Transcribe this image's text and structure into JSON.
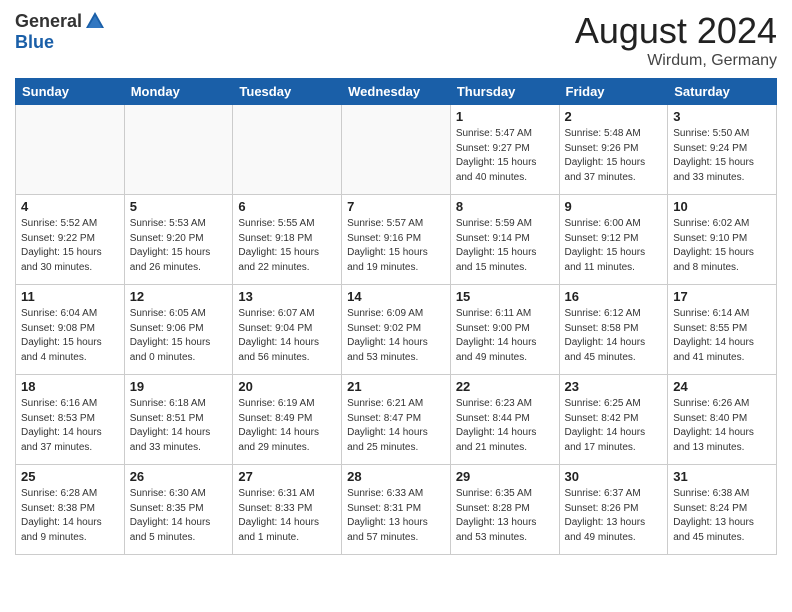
{
  "header": {
    "logo_general": "General",
    "logo_blue": "Blue",
    "month_year": "August 2024",
    "location": "Wirdum, Germany"
  },
  "days_of_week": [
    "Sunday",
    "Monday",
    "Tuesday",
    "Wednesday",
    "Thursday",
    "Friday",
    "Saturday"
  ],
  "weeks": [
    [
      {
        "day": "",
        "sunrise": "",
        "sunset": "",
        "daylight": ""
      },
      {
        "day": "",
        "sunrise": "",
        "sunset": "",
        "daylight": ""
      },
      {
        "day": "",
        "sunrise": "",
        "sunset": "",
        "daylight": ""
      },
      {
        "day": "",
        "sunrise": "",
        "sunset": "",
        "daylight": ""
      },
      {
        "day": "1",
        "sunrise": "5:47 AM",
        "sunset": "9:27 PM",
        "daylight": "15 hours and 40 minutes."
      },
      {
        "day": "2",
        "sunrise": "5:48 AM",
        "sunset": "9:26 PM",
        "daylight": "15 hours and 37 minutes."
      },
      {
        "day": "3",
        "sunrise": "5:50 AM",
        "sunset": "9:24 PM",
        "daylight": "15 hours and 33 minutes."
      }
    ],
    [
      {
        "day": "4",
        "sunrise": "5:52 AM",
        "sunset": "9:22 PM",
        "daylight": "15 hours and 30 minutes."
      },
      {
        "day": "5",
        "sunrise": "5:53 AM",
        "sunset": "9:20 PM",
        "daylight": "15 hours and 26 minutes."
      },
      {
        "day": "6",
        "sunrise": "5:55 AM",
        "sunset": "9:18 PM",
        "daylight": "15 hours and 22 minutes."
      },
      {
        "day": "7",
        "sunrise": "5:57 AM",
        "sunset": "9:16 PM",
        "daylight": "15 hours and 19 minutes."
      },
      {
        "day": "8",
        "sunrise": "5:59 AM",
        "sunset": "9:14 PM",
        "daylight": "15 hours and 15 minutes."
      },
      {
        "day": "9",
        "sunrise": "6:00 AM",
        "sunset": "9:12 PM",
        "daylight": "15 hours and 11 minutes."
      },
      {
        "day": "10",
        "sunrise": "6:02 AM",
        "sunset": "9:10 PM",
        "daylight": "15 hours and 8 minutes."
      }
    ],
    [
      {
        "day": "11",
        "sunrise": "6:04 AM",
        "sunset": "9:08 PM",
        "daylight": "15 hours and 4 minutes."
      },
      {
        "day": "12",
        "sunrise": "6:05 AM",
        "sunset": "9:06 PM",
        "daylight": "15 hours and 0 minutes."
      },
      {
        "day": "13",
        "sunrise": "6:07 AM",
        "sunset": "9:04 PM",
        "daylight": "14 hours and 56 minutes."
      },
      {
        "day": "14",
        "sunrise": "6:09 AM",
        "sunset": "9:02 PM",
        "daylight": "14 hours and 53 minutes."
      },
      {
        "day": "15",
        "sunrise": "6:11 AM",
        "sunset": "9:00 PM",
        "daylight": "14 hours and 49 minutes."
      },
      {
        "day": "16",
        "sunrise": "6:12 AM",
        "sunset": "8:58 PM",
        "daylight": "14 hours and 45 minutes."
      },
      {
        "day": "17",
        "sunrise": "6:14 AM",
        "sunset": "8:55 PM",
        "daylight": "14 hours and 41 minutes."
      }
    ],
    [
      {
        "day": "18",
        "sunrise": "6:16 AM",
        "sunset": "8:53 PM",
        "daylight": "14 hours and 37 minutes."
      },
      {
        "day": "19",
        "sunrise": "6:18 AM",
        "sunset": "8:51 PM",
        "daylight": "14 hours and 33 minutes."
      },
      {
        "day": "20",
        "sunrise": "6:19 AM",
        "sunset": "8:49 PM",
        "daylight": "14 hours and 29 minutes."
      },
      {
        "day": "21",
        "sunrise": "6:21 AM",
        "sunset": "8:47 PM",
        "daylight": "14 hours and 25 minutes."
      },
      {
        "day": "22",
        "sunrise": "6:23 AM",
        "sunset": "8:44 PM",
        "daylight": "14 hours and 21 minutes."
      },
      {
        "day": "23",
        "sunrise": "6:25 AM",
        "sunset": "8:42 PM",
        "daylight": "14 hours and 17 minutes."
      },
      {
        "day": "24",
        "sunrise": "6:26 AM",
        "sunset": "8:40 PM",
        "daylight": "14 hours and 13 minutes."
      }
    ],
    [
      {
        "day": "25",
        "sunrise": "6:28 AM",
        "sunset": "8:38 PM",
        "daylight": "14 hours and 9 minutes."
      },
      {
        "day": "26",
        "sunrise": "6:30 AM",
        "sunset": "8:35 PM",
        "daylight": "14 hours and 5 minutes."
      },
      {
        "day": "27",
        "sunrise": "6:31 AM",
        "sunset": "8:33 PM",
        "daylight": "14 hours and 1 minute."
      },
      {
        "day": "28",
        "sunrise": "6:33 AM",
        "sunset": "8:31 PM",
        "daylight": "13 hours and 57 minutes."
      },
      {
        "day": "29",
        "sunrise": "6:35 AM",
        "sunset": "8:28 PM",
        "daylight": "13 hours and 53 minutes."
      },
      {
        "day": "30",
        "sunrise": "6:37 AM",
        "sunset": "8:26 PM",
        "daylight": "13 hours and 49 minutes."
      },
      {
        "day": "31",
        "sunrise": "6:38 AM",
        "sunset": "8:24 PM",
        "daylight": "13 hours and 45 minutes."
      }
    ]
  ],
  "labels": {
    "sunrise": "Sunrise:",
    "sunset": "Sunset:",
    "daylight": "Daylight:"
  }
}
